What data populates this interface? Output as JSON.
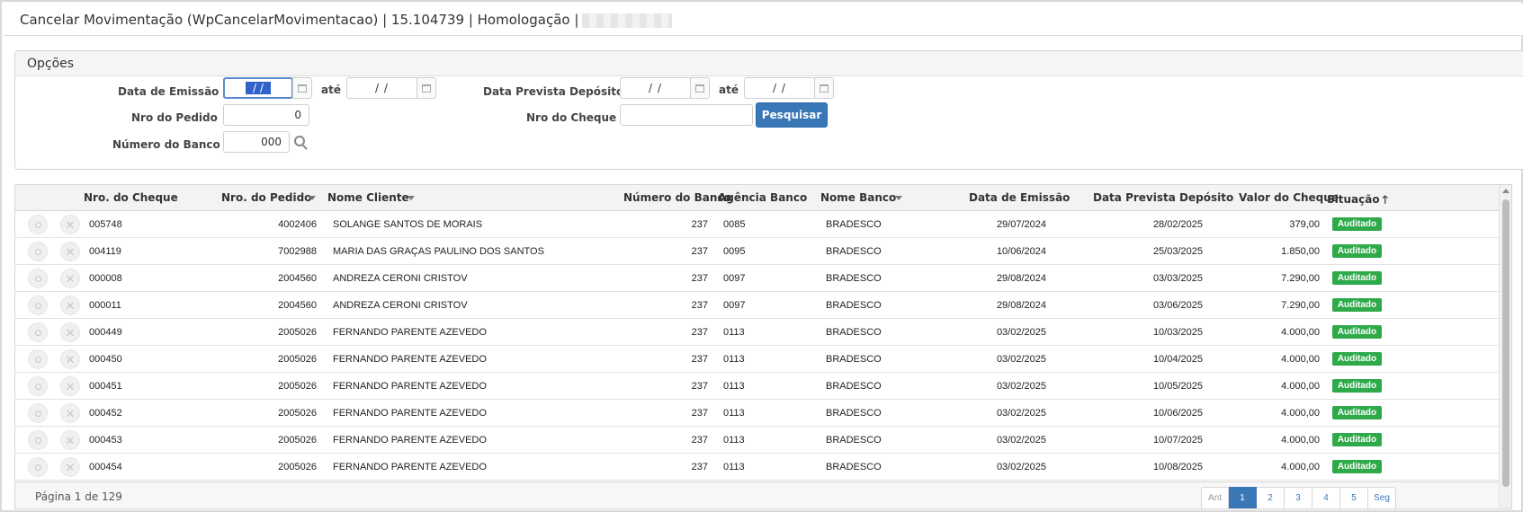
{
  "window": {
    "title": "Cancelar Movimentação (WpCancelarMovimentacao) | 15.104739 | Homologação |"
  },
  "options": {
    "title": "Opções",
    "data_emissao_label": "Data de Emissão",
    "data_emissao_de": " / / ",
    "ate_label": "até",
    "data_emissao_ate": "/ /",
    "data_prevista_label": "Data Prevista Depósito",
    "data_prevista_de": "/ /",
    "data_prevista_ate": "/ /",
    "nro_pedido_label": "Nro do Pedido",
    "nro_pedido_value": "0",
    "nro_cheque_label": "Nro do Cheque",
    "nro_cheque_value": "",
    "numero_banco_label": "Número do Banco",
    "numero_banco_value": "000",
    "pesquisar_label": "Pesquisar"
  },
  "grid": {
    "columns": {
      "nro_cheque": "Nro. do Cheque",
      "nro_pedido": "Nro. do Pedido",
      "nome_cliente": "Nome Cliente",
      "numero_banco": "Número do Banco",
      "agencia_banco": "Agência Banco",
      "nome_banco": "Nome Banco",
      "data_emissao": "Data de Emissão",
      "data_prevista": "Data Prevista Depósito",
      "valor_cheque": "Valor do Cheque",
      "situacao": "Situação"
    },
    "sort_up_glyph": "🡑",
    "rows": [
      {
        "cheque": "005748",
        "pedido": "4002406",
        "cliente": "SOLANGE SANTOS DE MORAIS",
        "banco": "237",
        "agencia": "0085",
        "nome_banco": "BRADESCO",
        "emissao": "29/07/2024",
        "prevista": "28/02/2025",
        "valor": "379,00",
        "situacao": "Auditado"
      },
      {
        "cheque": "004119",
        "pedido": "7002988",
        "cliente": "MARIA DAS GRAÇAS PAULINO DOS SANTOS",
        "banco": "237",
        "agencia": "0095",
        "nome_banco": "BRADESCO",
        "emissao": "10/06/2024",
        "prevista": "25/03/2025",
        "valor": "1.850,00",
        "situacao": "Auditado"
      },
      {
        "cheque": "000008",
        "pedido": "2004560",
        "cliente": "ANDREZA CERONI CRISTOV",
        "banco": "237",
        "agencia": "0097",
        "nome_banco": "BRADESCO",
        "emissao": "29/08/2024",
        "prevista": "03/03/2025",
        "valor": "7.290,00",
        "situacao": "Auditado"
      },
      {
        "cheque": "000011",
        "pedido": "2004560",
        "cliente": "ANDREZA CERONI CRISTOV",
        "banco": "237",
        "agencia": "0097",
        "nome_banco": "BRADESCO",
        "emissao": "29/08/2024",
        "prevista": "03/06/2025",
        "valor": "7.290,00",
        "situacao": "Auditado"
      },
      {
        "cheque": "000449",
        "pedido": "2005026",
        "cliente": "FERNANDO PARENTE AZEVEDO",
        "banco": "237",
        "agencia": "0113",
        "nome_banco": "BRADESCO",
        "emissao": "03/02/2025",
        "prevista": "10/03/2025",
        "valor": "4.000,00",
        "situacao": "Auditado"
      },
      {
        "cheque": "000450",
        "pedido": "2005026",
        "cliente": "FERNANDO PARENTE AZEVEDO",
        "banco": "237",
        "agencia": "0113",
        "nome_banco": "BRADESCO",
        "emissao": "03/02/2025",
        "prevista": "10/04/2025",
        "valor": "4.000,00",
        "situacao": "Auditado"
      },
      {
        "cheque": "000451",
        "pedido": "2005026",
        "cliente": "FERNANDO PARENTE AZEVEDO",
        "banco": "237",
        "agencia": "0113",
        "nome_banco": "BRADESCO",
        "emissao": "03/02/2025",
        "prevista": "10/05/2025",
        "valor": "4.000,00",
        "situacao": "Auditado"
      },
      {
        "cheque": "000452",
        "pedido": "2005026",
        "cliente": "FERNANDO PARENTE AZEVEDO",
        "banco": "237",
        "agencia": "0113",
        "nome_banco": "BRADESCO",
        "emissao": "03/02/2025",
        "prevista": "10/06/2025",
        "valor": "4.000,00",
        "situacao": "Auditado"
      },
      {
        "cheque": "000453",
        "pedido": "2005026",
        "cliente": "FERNANDO PARENTE AZEVEDO",
        "banco": "237",
        "agencia": "0113",
        "nome_banco": "BRADESCO",
        "emissao": "03/02/2025",
        "prevista": "10/07/2025",
        "valor": "4.000,00",
        "situacao": "Auditado"
      },
      {
        "cheque": "000454",
        "pedido": "2005026",
        "cliente": "FERNANDO PARENTE AZEVEDO",
        "banco": "237",
        "agencia": "0113",
        "nome_banco": "BRADESCO",
        "emissao": "03/02/2025",
        "prevista": "10/08/2025",
        "valor": "4.000,00",
        "situacao": "Auditado"
      }
    ],
    "status_color": "#2eaa4a"
  },
  "footer": {
    "page_info": "Página 1 de 129",
    "pager": [
      "Ant",
      "1",
      "2",
      "3",
      "4",
      "5",
      "Seg"
    ],
    "active_page": "1"
  }
}
